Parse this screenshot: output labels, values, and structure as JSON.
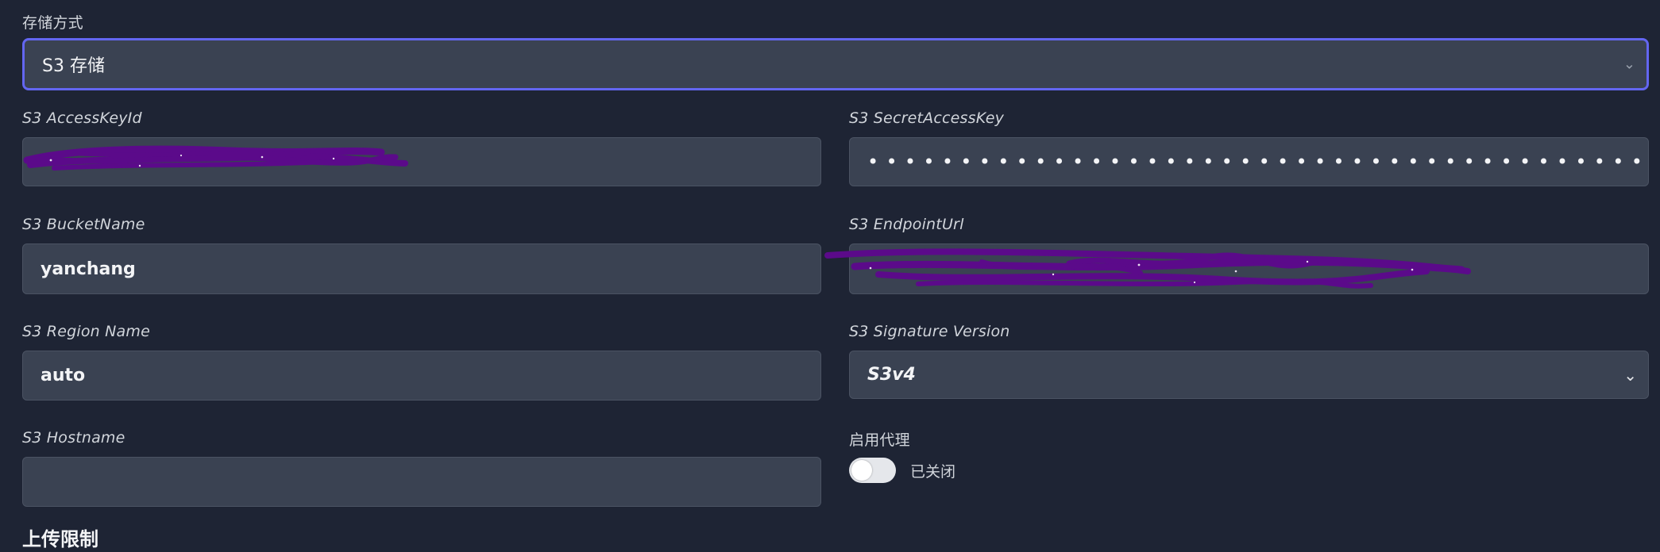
{
  "storage": {
    "label": "存储方式",
    "value": "S3 存储"
  },
  "access_key": {
    "label": "S3 AccessKeyId",
    "value": ""
  },
  "secret_key": {
    "label": "S3 SecretAccessKey",
    "masked": "••••••••••••••••••••••••••••••••••••••••••••"
  },
  "bucket": {
    "label": "S3 BucketName",
    "value": "yanchang"
  },
  "endpoint": {
    "label": "S3 EndpointUrl",
    "value": ""
  },
  "region": {
    "label": "S3 Region Name",
    "value": "auto"
  },
  "signature": {
    "label": "S3 Signature Version",
    "value": "S3v4"
  },
  "hostname": {
    "label": "S3 Hostname",
    "value": ""
  },
  "proxy": {
    "label": "启用代理",
    "state_text": "已关闭",
    "enabled": false
  },
  "upload_section": {
    "title": "上传限制"
  },
  "colors": {
    "background": "#1e2434",
    "field": "#3a4252",
    "focus_ring": "#6366f1",
    "redaction": "#5b0a8a"
  },
  "icons": {
    "select_chevron": "chevron-down-icon"
  }
}
